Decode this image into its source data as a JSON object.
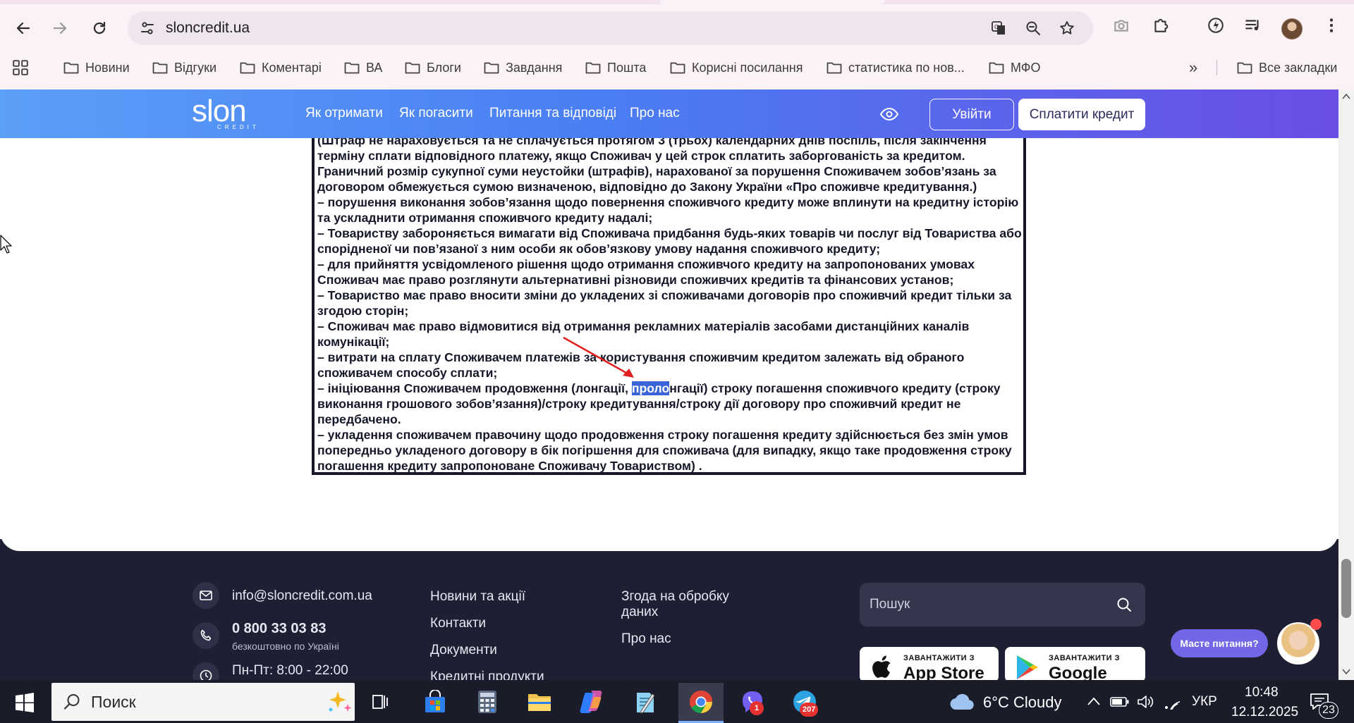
{
  "browser": {
    "url": "sloncredit.ua",
    "bookmarks": [
      "Новини",
      "Відгуки",
      "Коментарі",
      "ВА",
      "Блоги",
      "Завдання",
      "Пошта",
      "Корисні посилання",
      "статистика по нов...",
      "МФО"
    ],
    "more": "»",
    "all_bookmarks": "Все закладки"
  },
  "site": {
    "logo_word": "slon",
    "logo_sub": "CREDIT",
    "menu": [
      "Як отримати",
      "Як погасити",
      "Питання та відповіді",
      "Про нас"
    ],
    "login": "Увійти",
    "pay": "Сплатити кредит"
  },
  "document": {
    "lines": [
      "(Штраф не нараховується та не сплачується протягом 3 (трьох) календарних днів поспіль, після закінчення",
      "терміну сплати відповідного платежу, якщо Споживач у цей строк сплатить заборгованість за кредитом.",
      "Граничний розмір сукупної суми неустойки (штрафів), нарахованої за порушення Споживачем зобов’язань за",
      "договором обмежується сумою визначеною, відповідно до Закону України «Про споживче кредитування.)",
      "– порушення виконання зобов’язання щодо повернення споживчого кредиту може вплинути на кредитну історію",
      "та ускладнити отримання споживчого кредиту надалі;",
      "– Товариству забороняється вимагати від Споживача придбання будь-яких товарів чи послуг від Товариства або",
      "спорідненої чи пов’язаної з ним особи як обов’язкову умову надання споживчого кредиту;",
      "– для прийняття усвідомленого рішення щодо отримання споживчого кредиту на запропонованих умовах",
      "Споживач має право розглянути альтернативні різновиди споживчих кредитів та фінансових установ;",
      "– Товариство має право вносити зміни до укладених зі споживачами договорів про споживчий кредит тільки за",
      "згодою сторін;",
      "– Споживач має право відмовитися від отримання рекламних матеріалів засобами дистанційних каналів",
      "комунікації;",
      "– витрати на сплату Споживачем платежів за користування споживчим кредитом залежать від обраного",
      "споживачем способу сплати;"
    ],
    "highlight_before": "– ініціювання Споживачем продовження (лонгації, ",
    "highlight_text": "проло",
    "highlight_after": "нгації) строку погашення споживчого кредиту (строку",
    "lines_after": [
      "виконання грошового зобов’язання)/строку кредитування/строку дії договору про споживчий кредит не",
      "передбачено.",
      "– укладення споживачем правочину щодо продовження строку погашення кредиту здійснюється без змін умов",
      "попередньо укладеного договору в бік погіршення для споживача (для випадку, якщо таке продовження строку",
      "погашення кредиту запропоноване Споживачу Товариством) ."
    ]
  },
  "footer": {
    "email": "info@sloncredit.com.ua",
    "phone": "0 800 33 03 83",
    "phone_note": "безкоштовно по Україні",
    "hours": "Пн-Пт: 8:00 - 22:00",
    "col2": [
      "Новини та акції",
      "Контакти",
      "Документи",
      "Кредитні продукти"
    ],
    "col3_consent": [
      "Згода на обробку",
      "даних"
    ],
    "col3_about": "Про нас",
    "search_placeholder": "Пошук",
    "appstore_caption": "ЗАВАНТАЖИТИ З",
    "appstore_name": "App Store",
    "googleplay_caption": "ЗАВАНТАЖИТИ З",
    "googleplay_name": "Google Play",
    "chat_label": "Масте питання?"
  },
  "taskbar": {
    "search_placeholder": "Поиск",
    "viber_badge": "1",
    "telegram_badge": "207",
    "weather": "6°C  Cloudy",
    "lang": "УКР",
    "time": "10:48",
    "date": "12.12.2025",
    "notifications": "23"
  },
  "colors": {
    "header_start": "#5a9ff8",
    "header_end": "#6a4ee6",
    "footer_bg": "#1f1f33",
    "highlight": "#3b64d8"
  }
}
